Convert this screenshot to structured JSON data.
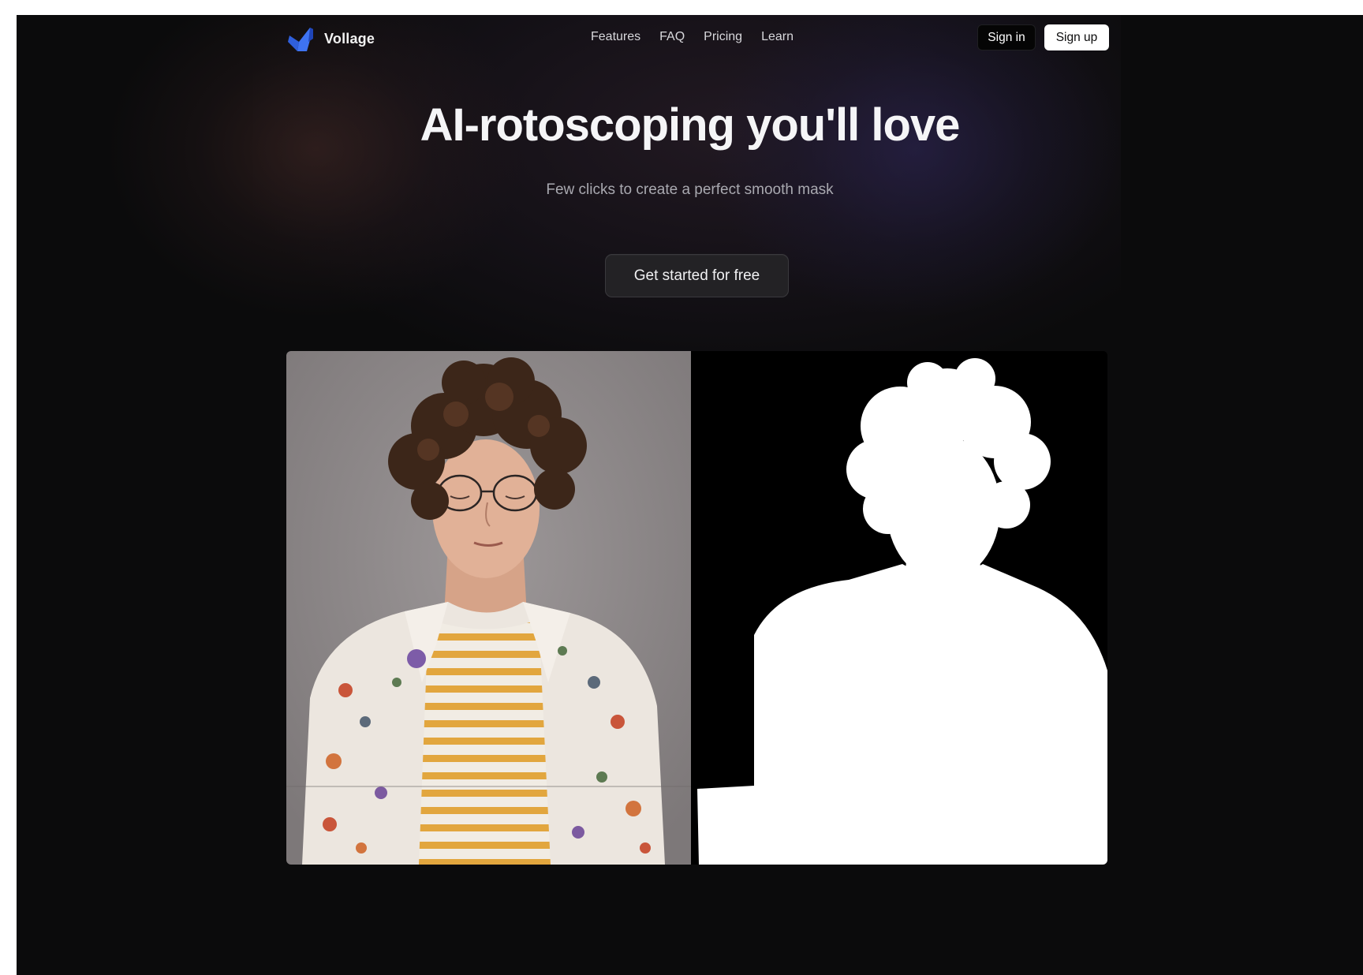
{
  "brand": {
    "name": "Vollage",
    "logo_icon": "vollage-logo-icon",
    "accent": "#3b6cf0"
  },
  "nav": {
    "links": [
      "Features",
      "FAQ",
      "Pricing",
      "Learn"
    ],
    "sign_in": "Sign in",
    "sign_up": "Sign up"
  },
  "hero": {
    "title": "AI-rotoscoping you'll love",
    "subtitle": "Few clicks to create a perfect smooth mask",
    "cta": "Get started for free"
  },
  "demo": {
    "photo_icon": "portrait-photo",
    "mask_icon": "portrait-mask"
  },
  "colors": {
    "background": "#0b0b0c",
    "photo_backdrop": "#8c8788",
    "shirt_stripes": "#e6b24a"
  }
}
